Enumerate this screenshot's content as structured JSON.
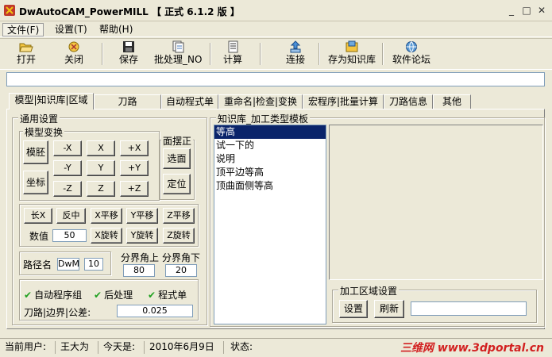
{
  "window": {
    "title": "DwAutoCAM_PowerMILL 【 正式 6.1.2 版 】"
  },
  "menus": [
    "文件(F)",
    "设置(T)",
    "帮助(H)"
  ],
  "toolbar": {
    "open": "打开",
    "close": "关闭",
    "save": "保存",
    "batch": "批处理_NO",
    "calc": "计算",
    "connect": "连接",
    "save_kb": "存为知识库",
    "forum": "软件论坛"
  },
  "info_text": "",
  "tabs": [
    "模型|知识库|区域",
    "刀路",
    "自动程式单",
    "重命名|检查|变换",
    "宏程序|批量计算",
    "刀路信息",
    "其他"
  ],
  "general": {
    "title": "通用设置",
    "model_transform": {
      "title": "模型变换",
      "blank": "模胚",
      "coord": "坐标",
      "grid": [
        [
          "-X",
          "X",
          "+X"
        ],
        [
          "-Y",
          "Y",
          "+Y"
        ],
        [
          "-Z",
          "Z",
          "+Z"
        ]
      ]
    },
    "face_correct": {
      "title": "面摆正",
      "select": "选面",
      "locate": "定位"
    },
    "row1": [
      "长X",
      "反中",
      "X平移",
      "Y平移",
      "Z平移"
    ],
    "value_label": "数值",
    "value": "50",
    "row2": [
      "X旋转",
      "Y旋转",
      "Z旋转"
    ],
    "path_label": "路径名",
    "path_prefix": "DwM",
    "path_value": "10",
    "boundary_up_label": "分界角上",
    "boundary_up": "80",
    "boundary_down_label": "分界角下",
    "boundary_down": "20",
    "checks": [
      "自动程序组",
      "后处理",
      "程式单"
    ],
    "tolerance_label": "刀路|边界|公差:",
    "tolerance": "0.025"
  },
  "knowledge": {
    "title": "知识库_加工类型模板",
    "items": [
      "等高",
      "试一下的",
      "说明",
      "顶平边等高",
      "顶曲面侧等高"
    ],
    "selected_index": 0
  },
  "region": {
    "title": "加工区域设置",
    "set": "设置",
    "refresh": "刷新",
    "value": ""
  },
  "status": {
    "user_label": "当前用户:",
    "user": "王大为",
    "today_label": "今天是:",
    "date": "2010年6月9日",
    "state_label": "状态:"
  },
  "watermark": "三维网 www.3dportal.cn"
}
